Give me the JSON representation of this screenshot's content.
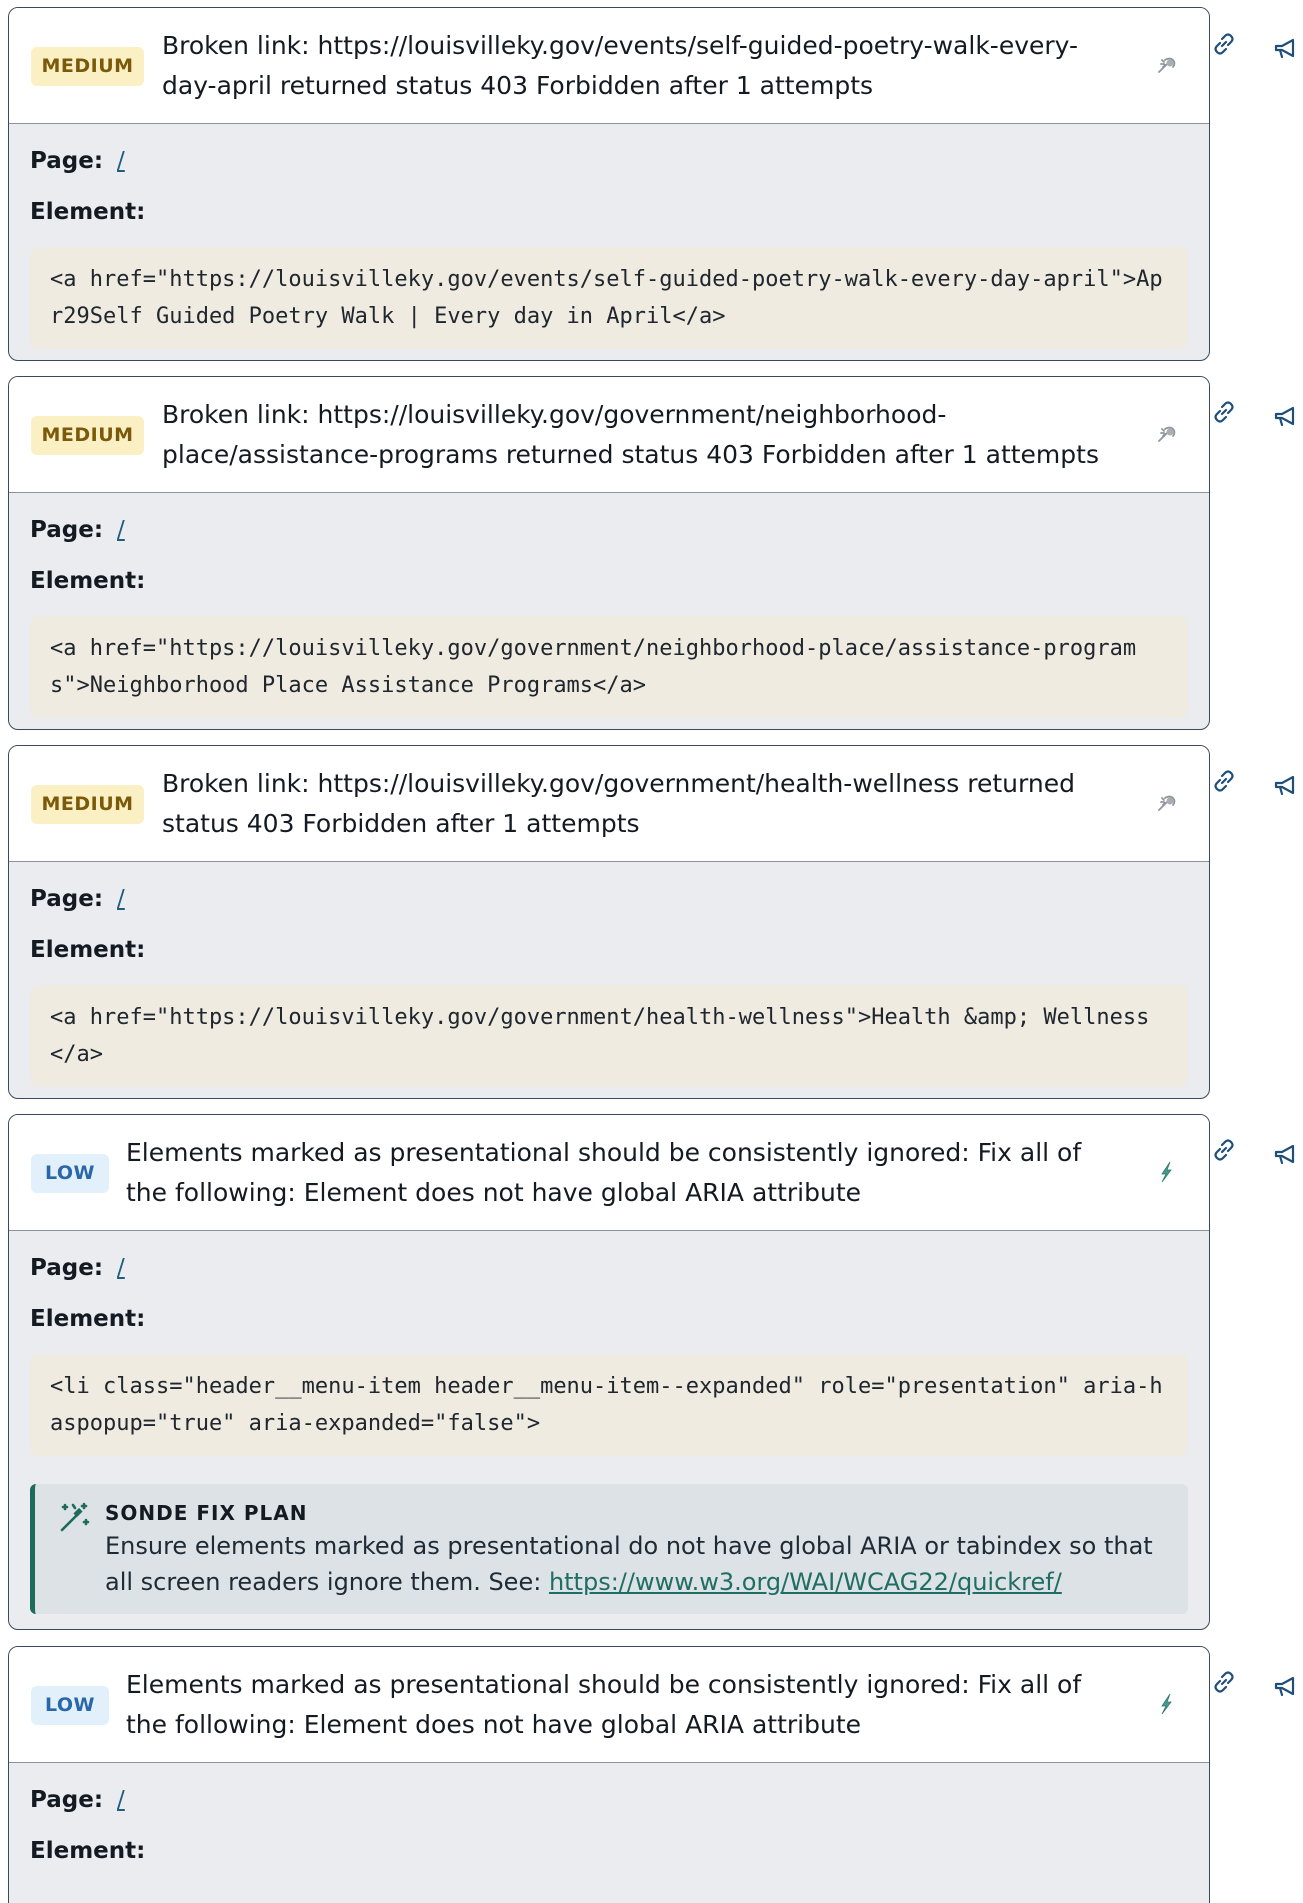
{
  "issues": [
    {
      "severity": "MEDIUM",
      "title": "Broken link: https://louisvilleky.gov/events/self-guided-poetry-walk-every-day-april returned status 403 Forbidden after 1 attempts",
      "page_label": "Page:",
      "page_link": "/",
      "element_label": "Element:",
      "code": "<a href=\"https://louisvilleky.gov/events/self-guided-poetry-walk-every-day-april\">Apr29Self Guided Poetry Walk | Every day in April</a>",
      "head_icon": "bug-icon"
    },
    {
      "severity": "MEDIUM",
      "title": "Broken link: https://louisvilleky.gov/government/neighborhood-place/assistance-programs returned status 403 Forbidden after 1 attempts",
      "page_label": "Page:",
      "page_link": "/",
      "element_label": "Element:",
      "code": "<a href=\"https://louisvilleky.gov/government/neighborhood-place/assistance-programs\">Neighborhood Place Assistance Programs</a>",
      "head_icon": "bug-icon"
    },
    {
      "severity": "MEDIUM",
      "title": "Broken link: https://louisvilleky.gov/government/health-wellness returned status 403 Forbidden after 1 attempts",
      "page_label": "Page:",
      "page_link": "/",
      "element_label": "Element:",
      "code": "<a href=\"https://louisvilleky.gov/government/health-wellness\">Health &amp; Wellness</a>",
      "head_icon": "bug-icon"
    },
    {
      "severity": "LOW",
      "title": "Elements marked as presentational should be consistently ignored: Fix all of the following: Element does not have global ARIA attribute",
      "page_label": "Page:",
      "page_link": "/",
      "element_label": "Element:",
      "code": "<li class=\"header__menu-item header__menu-item--expanded\" role=\"presentation\" aria-haspopup=\"true\" aria-expanded=\"false\">",
      "head_icon": "lightning-icon",
      "fix_plan": {
        "title": "SONDE FIX PLAN",
        "text": "Ensure elements marked as presentational do not have global ARIA or tabindex so that all screen readers ignore them. See: ",
        "link": "https://www.w3.org/WAI/WCAG22/quickref/"
      }
    },
    {
      "severity": "LOW",
      "title": "Elements marked as presentational should be consistently ignored: Fix all of the following: Element does not have global ARIA attribute",
      "page_label": "Page:",
      "page_link": "/",
      "element_label": "Element:",
      "head_icon": "lightning-icon"
    }
  ],
  "side_icons": [
    "link-icon",
    "megaphone-icon"
  ],
  "colors": {
    "medium_badge_bg": "#fbf0c4",
    "medium_badge_text": "#7a5a0a",
    "low_badge_bg": "#e2f0fc",
    "low_badge_text": "#2a67a8",
    "fix_plan_accent": "#1e6b5c",
    "code_bg": "#efebe1"
  }
}
